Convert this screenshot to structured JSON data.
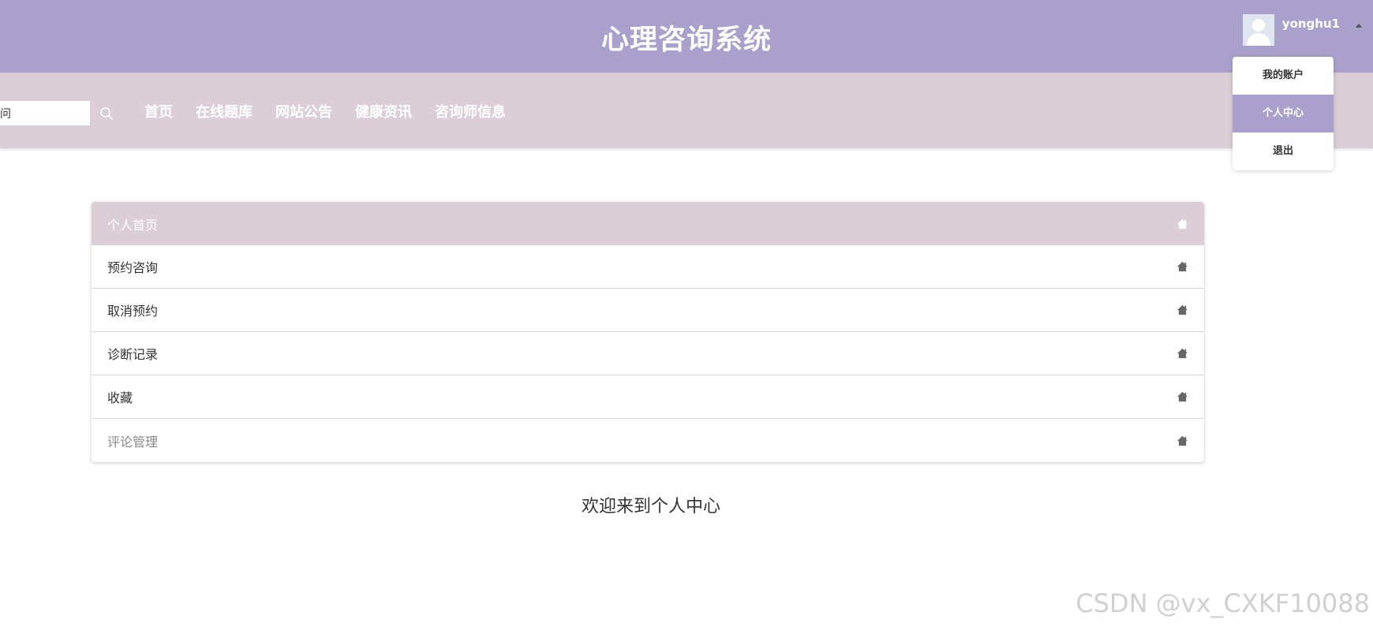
{
  "header": {
    "title": "心理咨询系统",
    "username": "yonghu1"
  },
  "nav": {
    "search_value": "问",
    "items": [
      "首页",
      "在线题库",
      "网站公告",
      "健康资讯",
      "咨询师信息"
    ]
  },
  "user_menu": {
    "items": [
      "我的账户",
      "个人中心",
      "退出"
    ],
    "active_index": 1
  },
  "side_menu": {
    "items": [
      "个人首页",
      "预约咨询",
      "取消预约",
      "诊断记录",
      "收藏",
      "评论管理"
    ],
    "active_index": 0
  },
  "main": {
    "welcome": "欢迎来到个人中心"
  },
  "watermark": "CSDN @vx_CXKF10088",
  "colors": {
    "header_bg": "#a9a1cb",
    "nav_bg": "#dbced7",
    "accent": "#a9a1cb"
  }
}
